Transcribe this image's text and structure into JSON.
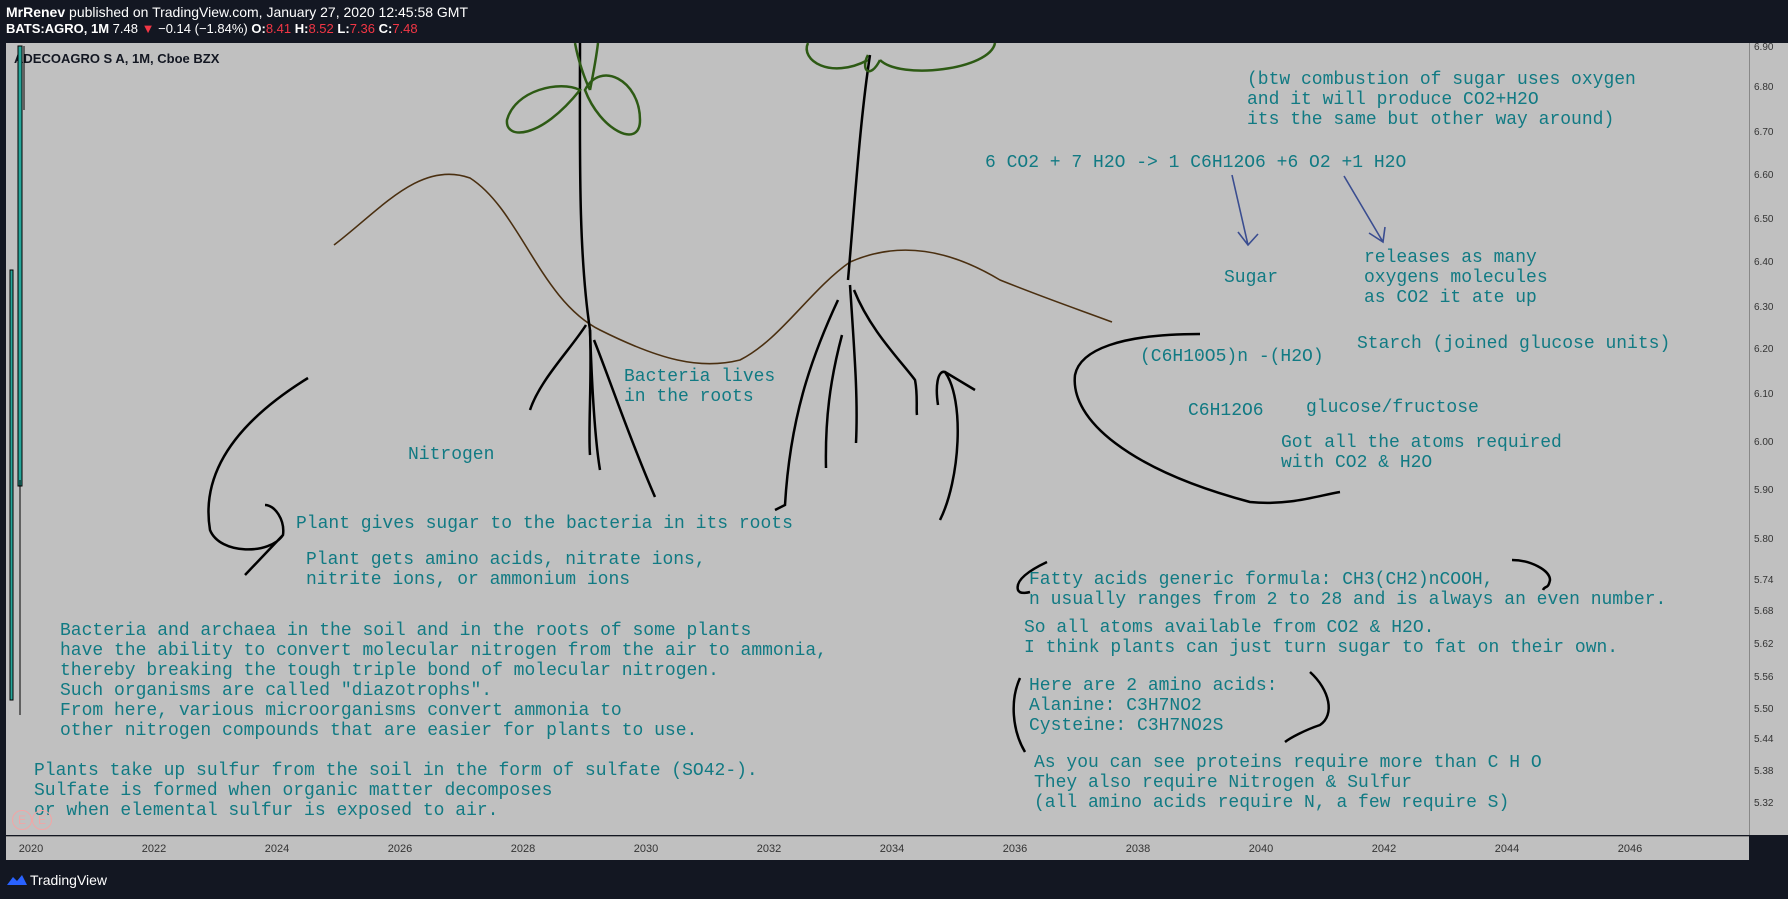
{
  "header": {
    "author": "MrRenev",
    "published": " published on TradingView.com, January 27, 2020 12:45:58 GMT",
    "symbol": "BATS:AGRO, 1M",
    "last": "7.48",
    "change": "−0.14 (−1.84%)",
    "o_label": "O:",
    "o": "8.41",
    "h_label": "H:",
    "h": "8.52",
    "l_label": "L:",
    "l": "7.36",
    "c_label": "C:",
    "c": "7.48"
  },
  "chart_title": "ADECOAGRO S A, 1M, Cboe BZX",
  "chart_data": {
    "type": "line",
    "title": "ADECOAGRO S A, 1M, Cboe BZX",
    "price_ticks": [
      "6.90",
      "6.80",
      "6.70",
      "6.60",
      "6.50",
      "6.40",
      "6.30",
      "6.20",
      "6.10",
      "6.00",
      "5.90",
      "5.80",
      "5.74",
      "5.68",
      "5.62",
      "5.56",
      "5.50",
      "5.44",
      "5.38",
      "5.32"
    ],
    "time_ticks": [
      "2020",
      "2022",
      "2024",
      "2026",
      "2028",
      "2030",
      "2032",
      "2034",
      "2036",
      "2038",
      "2040",
      "2042",
      "2044",
      "2046"
    ],
    "ohlc": {
      "open": 8.41,
      "high": 8.52,
      "low": 7.36,
      "close": 7.48
    }
  },
  "notes": {
    "n1": "(btw combustion of sugar uses oxygen\nand it will produce CO2+H2O\nits the same but other way around)",
    "n2": "6 CO2 + 7 H2O -> 1 C6H12O6 +6 O2 +1 H2O",
    "n3": "Sugar",
    "n4": "releases as many\noxygens molecules\nas CO2 it ate up",
    "n5": "Starch (joined glucose units)",
    "n6": "(C6H10O5)n -(H2O)",
    "n7": "C6H12O6",
    "n8": "glucose/fructose",
    "n9": "Got all the atoms required\nwith CO2 & H2O",
    "n10": "Bacteria lives\nin the roots",
    "n11": "Nitrogen",
    "n12": "Plant gives sugar to the bacteria in its roots",
    "n13": "Plant gets amino acids, nitrate ions,\nnitrite ions, or ammonium ions",
    "n14": "Bacteria and archaea in the soil and in the roots of some plants\nhave the ability to convert molecular nitrogen from the air to ammonia,\nthereby breaking the tough triple bond of molecular nitrogen.\nSuch organisms are called \"diazotrophs\".\nFrom here, various microorganisms convert ammonia to\nother nitrogen compounds that are easier for plants to use.",
    "n15": "Plants take up sulfur from the soil in the form of sulfate (SO42-).\nSulfate is formed when organic matter decomposes\nor when elemental sulfur is exposed to air.",
    "n16": "Fatty acids generic formula: CH3(CH2)nCOOH,\nn usually ranges from 2 to 28 and is always an even number.",
    "n17": "So all atoms available from CO2 & H2O.\nI think plants can just turn sugar to fat on their own.",
    "n18": "Here are 2 amino acids:\nAlanine: C3H7NO2\nCysteine: C3H7NO2S",
    "n19": "As you can see proteins require more than C H O\nThey also require Nitrogen & Sulfur\n(all amino acids require N, a few require S)"
  },
  "events": [
    "E",
    "E"
  ],
  "footer": {
    "brand": "TradingView"
  }
}
